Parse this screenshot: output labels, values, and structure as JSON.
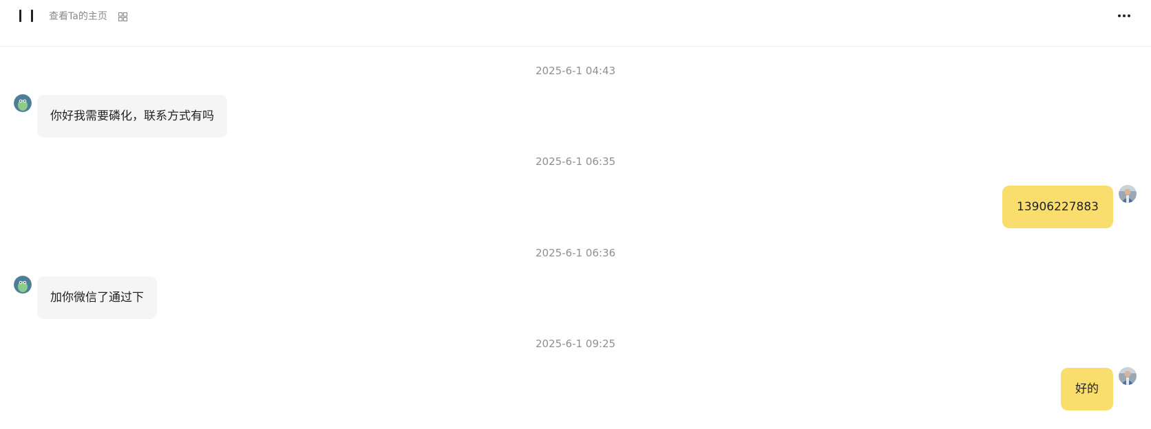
{
  "header": {
    "profile_link": "查看Ta的主页",
    "qr_icon": "qr-code-icon",
    "more_icon": "more-horizontal-icon"
  },
  "colors": {
    "incoming_bubble": "#f5f5f5",
    "outgoing_bubble": "#f9de6d",
    "timestamp": "#8f8f8f"
  },
  "messages": [
    {
      "timestamp": "2025-6-1 04:43",
      "direction": "incoming",
      "text": "你好我需要磷化，联系方式有吗"
    },
    {
      "timestamp": "2025-6-1 06:35",
      "direction": "outgoing",
      "text": "13906227883"
    },
    {
      "timestamp": "2025-6-1 06:36",
      "direction": "incoming",
      "text": "加你微信了通过下"
    },
    {
      "timestamp": "2025-6-1 09:25",
      "direction": "outgoing",
      "text": "好的"
    }
  ]
}
